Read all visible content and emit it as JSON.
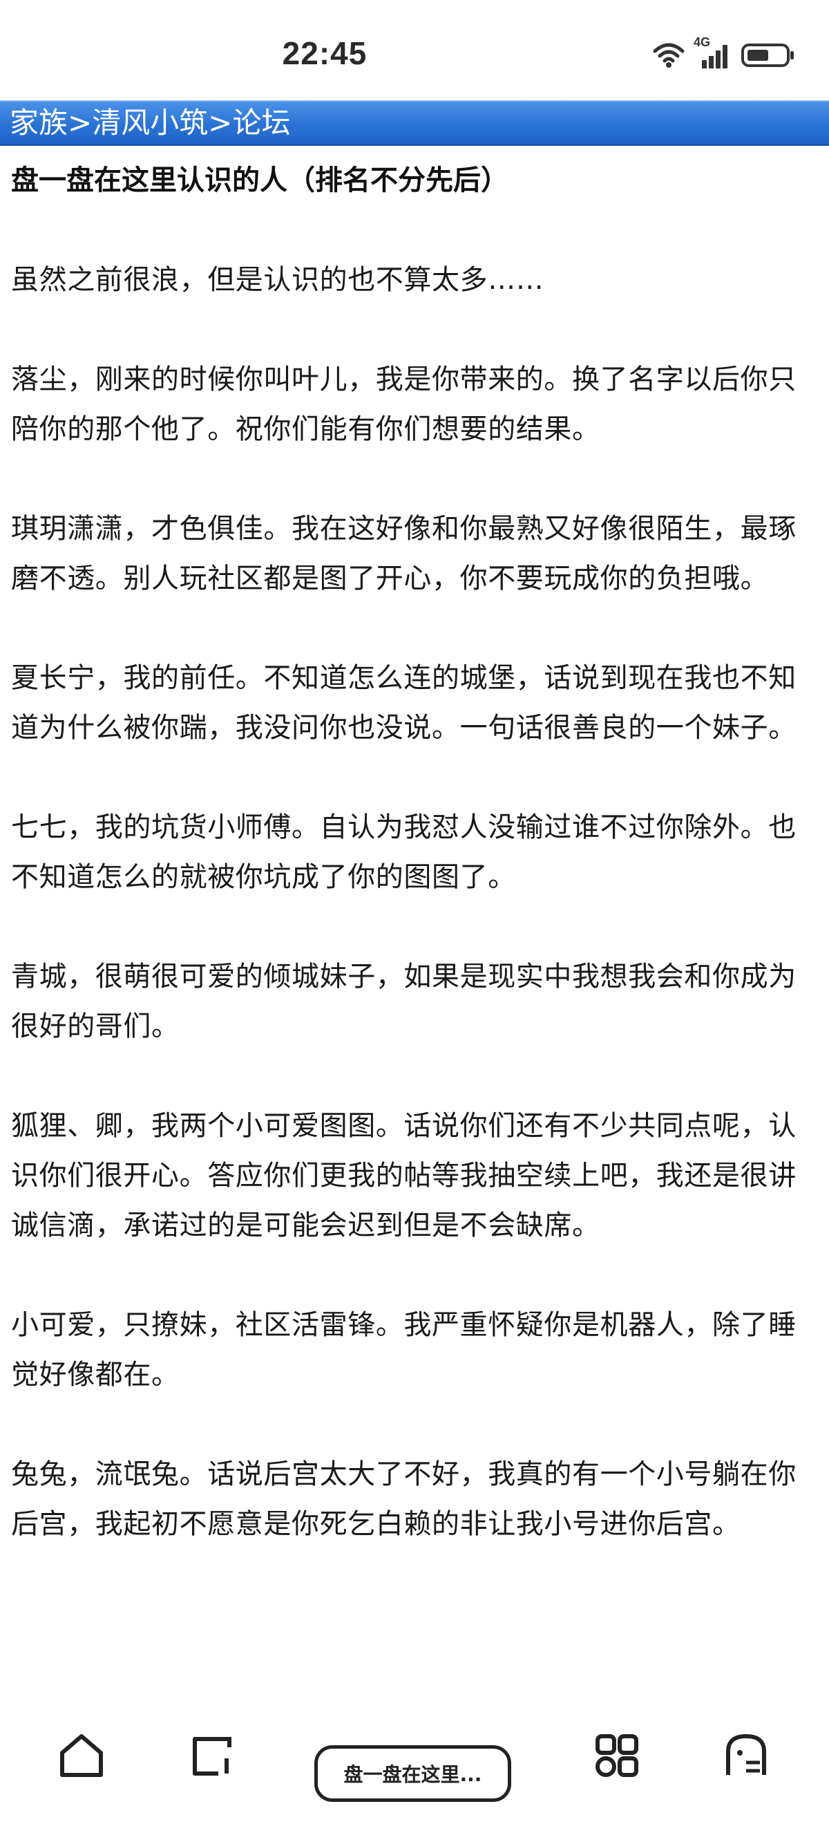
{
  "status_bar": {
    "time": "22:45",
    "network": "4G",
    "icons": [
      "wifi-icon",
      "cellular-signal-icon",
      "battery-icon"
    ]
  },
  "breadcrumb": {
    "items": [
      "家族",
      "清风小筑",
      "论坛"
    ],
    "separator": ">",
    "background_color": "#2a73d6"
  },
  "post": {
    "title": "盘一盘在这里认识的人（排名不分先后）",
    "paragraphs": [
      "虽然之前很浪，但是认识的也不算太多……",
      "落尘，刚来的时候你叫叶儿，我是你带来的。换了名字以后你只陪你的那个他了。祝你们能有你们想要的结果。",
      "琪玥潇潇，才色俱佳。我在这好像和你最熟又好像很陌生，最琢磨不透。别人玩社区都是图了开心，你不要玩成你的负担哦。",
      "夏长宁，我的前任。不知道怎么连的城堡，话说到现在我也不知道为什么被你踹，我没问你也没说。一句话很善良的一个妹子。",
      "七七，我的坑货小师傅。自认为我怼人没输过谁不过你除外。也不知道怎么的就被你坑成了你的图图了。",
      "青城，很萌很可爱的倾城妹子，如果是现实中我想我会和你成为很好的哥们。",
      "狐狸、卿，我两个小可爱图图。话说你们还有不少共同点呢，认识你们很开心。答应你们更我的帖等我抽空续上吧，我还是很讲诚信滴，承诺过的是可能会迟到但是不会缺席。",
      "小可爱，只撩妹，社区活雷锋。我严重怀疑你是机器人，除了睡觉好像都在。",
      "兔兔，流氓兔。话说后宫太大了不好，我真的有一个小号躺在你后宫，我起初不愿意是你死乞白赖的非让我小号进你后宫。"
    ]
  },
  "bottom_nav": {
    "current_tab_label": "盘一盘在这里...",
    "icons": [
      "home-icon",
      "tab-switch-icon",
      "apps-grid-icon",
      "ghost-menu-icon"
    ]
  }
}
